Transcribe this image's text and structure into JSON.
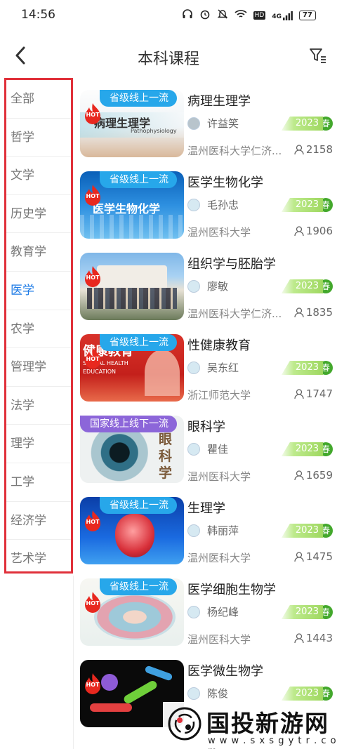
{
  "status_bar": {
    "time": "14:56",
    "battery": "77",
    "signal_label": "4G",
    "hd_label": "HD"
  },
  "header": {
    "title": "本科课程"
  },
  "sidebar": {
    "items": [
      {
        "label": "全部"
      },
      {
        "label": "哲学"
      },
      {
        "label": "文学"
      },
      {
        "label": "历史学"
      },
      {
        "label": "教育学"
      },
      {
        "label": "医学"
      },
      {
        "label": "农学"
      },
      {
        "label": "管理学"
      },
      {
        "label": "法学"
      },
      {
        "label": "理学"
      },
      {
        "label": "工学"
      },
      {
        "label": "经济学"
      },
      {
        "label": "艺术学"
      }
    ],
    "active": "医学"
  },
  "hot_label": "HOT",
  "courses": [
    {
      "title": "病理生理学",
      "tag": "省级线上一流",
      "tag_color": "blue",
      "teacher": "许益笑",
      "school": "温州医科大学仁济...",
      "year": "2023",
      "season": "春",
      "count": "2158",
      "thumb_caption": "病理生理学",
      "thumb_sub": "Pathophysiology"
    },
    {
      "title": "医学生物化学",
      "tag": "省级线上一流",
      "tag_color": "blue",
      "teacher": "毛孙忠",
      "school": "温州医科大学",
      "year": "2023",
      "season": "春",
      "count": "1906",
      "thumb_caption": "医学生物化学"
    },
    {
      "title": "组织学与胚胎学",
      "tag": "",
      "teacher": "廖敏",
      "school": "温州医科大学仁济...",
      "year": "2023",
      "season": "春",
      "count": "1835"
    },
    {
      "title": "性健康教育",
      "tag": "省级线上一流",
      "tag_color": "blue",
      "teacher": "吴东红",
      "school": "浙江师范大学",
      "year": "2023",
      "season": "春",
      "count": "1747",
      "thumb_caption": "健康教育",
      "thumb_sub": "SEXUAL HEALTH EDUCATION"
    },
    {
      "title": "眼科学",
      "tag": "国家线上线下一流",
      "tag_color": "purple",
      "teacher": "瞿佳",
      "school": "温州医科大学",
      "year": "2023",
      "season": "春",
      "count": "1659",
      "thumb_caption": "眼科学"
    },
    {
      "title": "生理学",
      "tag": "省级线上一流",
      "tag_color": "blue",
      "teacher": "韩丽萍",
      "school": "温州医科大学",
      "year": "2023",
      "season": "春",
      "count": "1475"
    },
    {
      "title": "医学细胞生物学",
      "tag": "省级线上一流",
      "tag_color": "blue",
      "teacher": "杨纪峰",
      "school": "温州医科大学",
      "year": "2023",
      "season": "春",
      "count": "1443"
    },
    {
      "title": "医学微生物学",
      "tag": "",
      "teacher": "陈俊",
      "school": "",
      "year": "2023",
      "season": "春",
      "count": ""
    }
  ],
  "watermark": {
    "name": "国投新游网",
    "url": "w w w . s x s g y t r . c o m"
  },
  "colors": {
    "accent": "#1e7be6",
    "highlight_border": "#e0303a",
    "tag_blue": "#27a7ea",
    "tag_purple": "#8c66d9",
    "season_green": "#43a82c"
  }
}
